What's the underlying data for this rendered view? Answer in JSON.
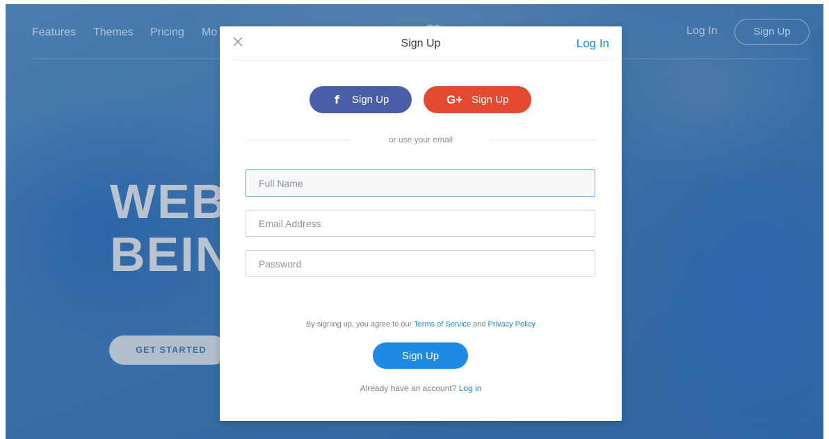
{
  "background": {
    "nav": {
      "links": [
        "Features",
        "Themes",
        "Pricing",
        "Mo"
      ],
      "login": "Log In",
      "signup": "Sign Up"
    },
    "hero": {
      "title_line1": "WEB",
      "title_line2": "BEIN",
      "cta": "GET STARTED"
    }
  },
  "modal": {
    "title": "Sign Up",
    "login_link": "Log In",
    "facebook": {
      "icon": "f",
      "label": "Sign Up",
      "color": "#4a5fa8"
    },
    "google": {
      "icon": "G+",
      "label": "Sign Up",
      "color": "#e34a2f"
    },
    "divider_text": "or use your email",
    "fields": {
      "full_name": {
        "placeholder": "Full Name"
      },
      "email": {
        "placeholder": "Email Address"
      },
      "password": {
        "placeholder": "Password"
      }
    },
    "terms": {
      "prefix": "By signing up, you agree to our",
      "tos": "Terms of Service",
      "and": "and",
      "privacy": "Privacy Policy"
    },
    "submit": "Sign Up",
    "footer": {
      "text": "Already have an account?",
      "link": "Log in"
    }
  },
  "colors": {
    "accent": "#1f86d6",
    "background_blue": "#3f74a8"
  }
}
